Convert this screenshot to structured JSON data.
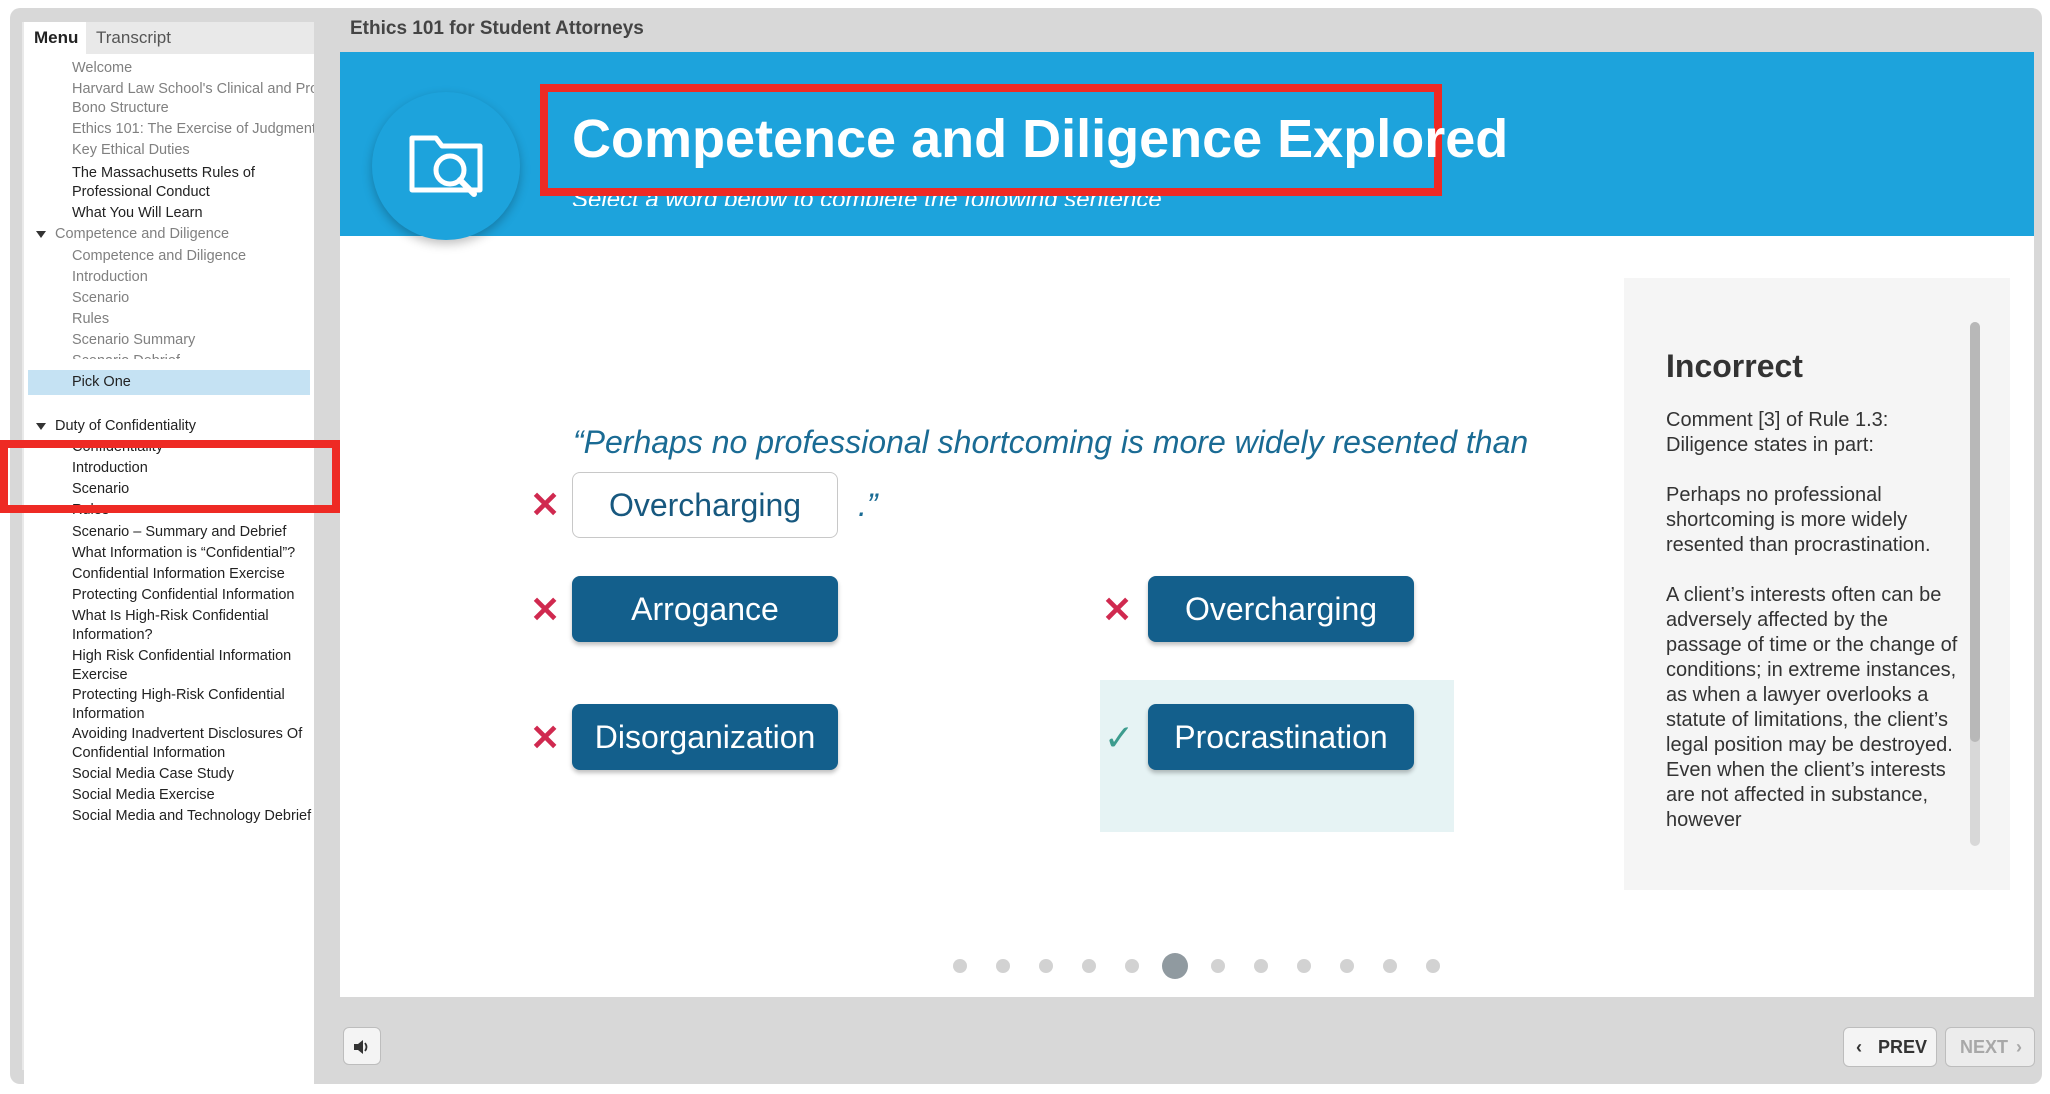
{
  "course_title": "Ethics 101 for Student Attorneys",
  "sidebar": {
    "tabs": [
      "Menu",
      "Transcript"
    ],
    "items": [
      {
        "label": "Welcome",
        "style": "dim"
      },
      {
        "label": "Harvard Law School's Clinical and Pro",
        "style": "dim"
      },
      {
        "label": "Bono Structure",
        "style": "dim"
      },
      {
        "label": "Ethics 101: The Exercise of Judgment",
        "style": "dim"
      },
      {
        "label": "Key Ethical Duties",
        "style": "dim"
      },
      {
        "label": "The Massachusetts Rules of",
        "style": "normal"
      },
      {
        "label": "Professional Conduct",
        "style": "normal"
      },
      {
        "label": "What You Will Learn",
        "style": "normal"
      },
      {
        "label": "Competence and Diligence",
        "style": "dim",
        "section": true
      },
      {
        "label": "Competence and Diligence",
        "style": "dim"
      },
      {
        "label": "Introduction",
        "style": "dim"
      },
      {
        "label": "Scenario",
        "style": "dim"
      },
      {
        "label": "Rules",
        "style": "dim"
      },
      {
        "label": "Scenario Summary",
        "style": "dim"
      },
      {
        "label": "Scenario Debrief",
        "style": "dim"
      },
      {
        "label": "Pick One",
        "style": "selected"
      },
      {
        "label": "Duty of Confidentiality",
        "style": "normal",
        "section": true
      },
      {
        "label": "Confidentiality",
        "style": "normal"
      },
      {
        "label": "Introduction",
        "style": "normal"
      },
      {
        "label": "Scenario",
        "style": "normal"
      },
      {
        "label": "Rules",
        "style": "normal"
      },
      {
        "label": "Scenario – Summary and Debrief",
        "style": "normal"
      },
      {
        "label": "What Information is “Confidential”?",
        "style": "normal"
      },
      {
        "label": "Confidential Information Exercise",
        "style": "normal"
      },
      {
        "label": "Protecting Confidential Information",
        "style": "normal"
      },
      {
        "label": "What Is High-Risk Confidential",
        "style": "normal"
      },
      {
        "label": "Information?",
        "style": "normal"
      },
      {
        "label": "High Risk Confidential Information",
        "style": "normal"
      },
      {
        "label": "Exercise",
        "style": "normal"
      },
      {
        "label": "Protecting High-Risk Confidential",
        "style": "normal"
      },
      {
        "label": "Information",
        "style": "normal"
      },
      {
        "label": "Avoiding Inadvertent Disclosures Of",
        "style": "normal"
      },
      {
        "label": "Confidential Information",
        "style": "normal"
      },
      {
        "label": "Social Media Case Study",
        "style": "normal"
      },
      {
        "label": "Social Media Exercise",
        "style": "normal"
      },
      {
        "label": "Social Media and Technology Debrief",
        "style": "normal"
      }
    ]
  },
  "slide": {
    "title": "Competence and Diligence Explored",
    "subtitle": "Select a word below to complete the following sentence",
    "quote": "“Perhaps no professional shortcoming is more widely resented  than",
    "blank_value": "Overcharging",
    "quote_end": ".”",
    "choices": {
      "arrogance": "Arrogance",
      "overcharging": "Overcharging",
      "disorganization": "Disorganization",
      "procrastination": "Procrastination"
    },
    "marks": {
      "wrong": "✕",
      "right": "✓"
    }
  },
  "feedback": {
    "title": "Incorrect",
    "paragraphs": [
      "Comment [3] of Rule 1.3: Diligence states in part:",
      "Perhaps no professional shortcoming is more widely resented than procrastination.",
      "A client’s interests often can be adversely affected by the passage of time or the change of conditions; in extreme instances, as when a lawyer overlooks a statute of limitations, the client’s legal position may be destroyed. Even when the client’s interests are not affected in substance, however"
    ]
  },
  "progress": {
    "total_slides": 12,
    "current_slide": 6
  },
  "nav": {
    "prev_label": "PREV",
    "next_label": "NEXT",
    "prev_icon": "chevron-left-icon",
    "next_icon": "chevron-right-icon"
  },
  "colors": {
    "banner": "#1da3dc",
    "button": "#135f8c",
    "wrong": "#d0294f",
    "right": "#3d9c8e",
    "highlight": "#ee2a24"
  }
}
